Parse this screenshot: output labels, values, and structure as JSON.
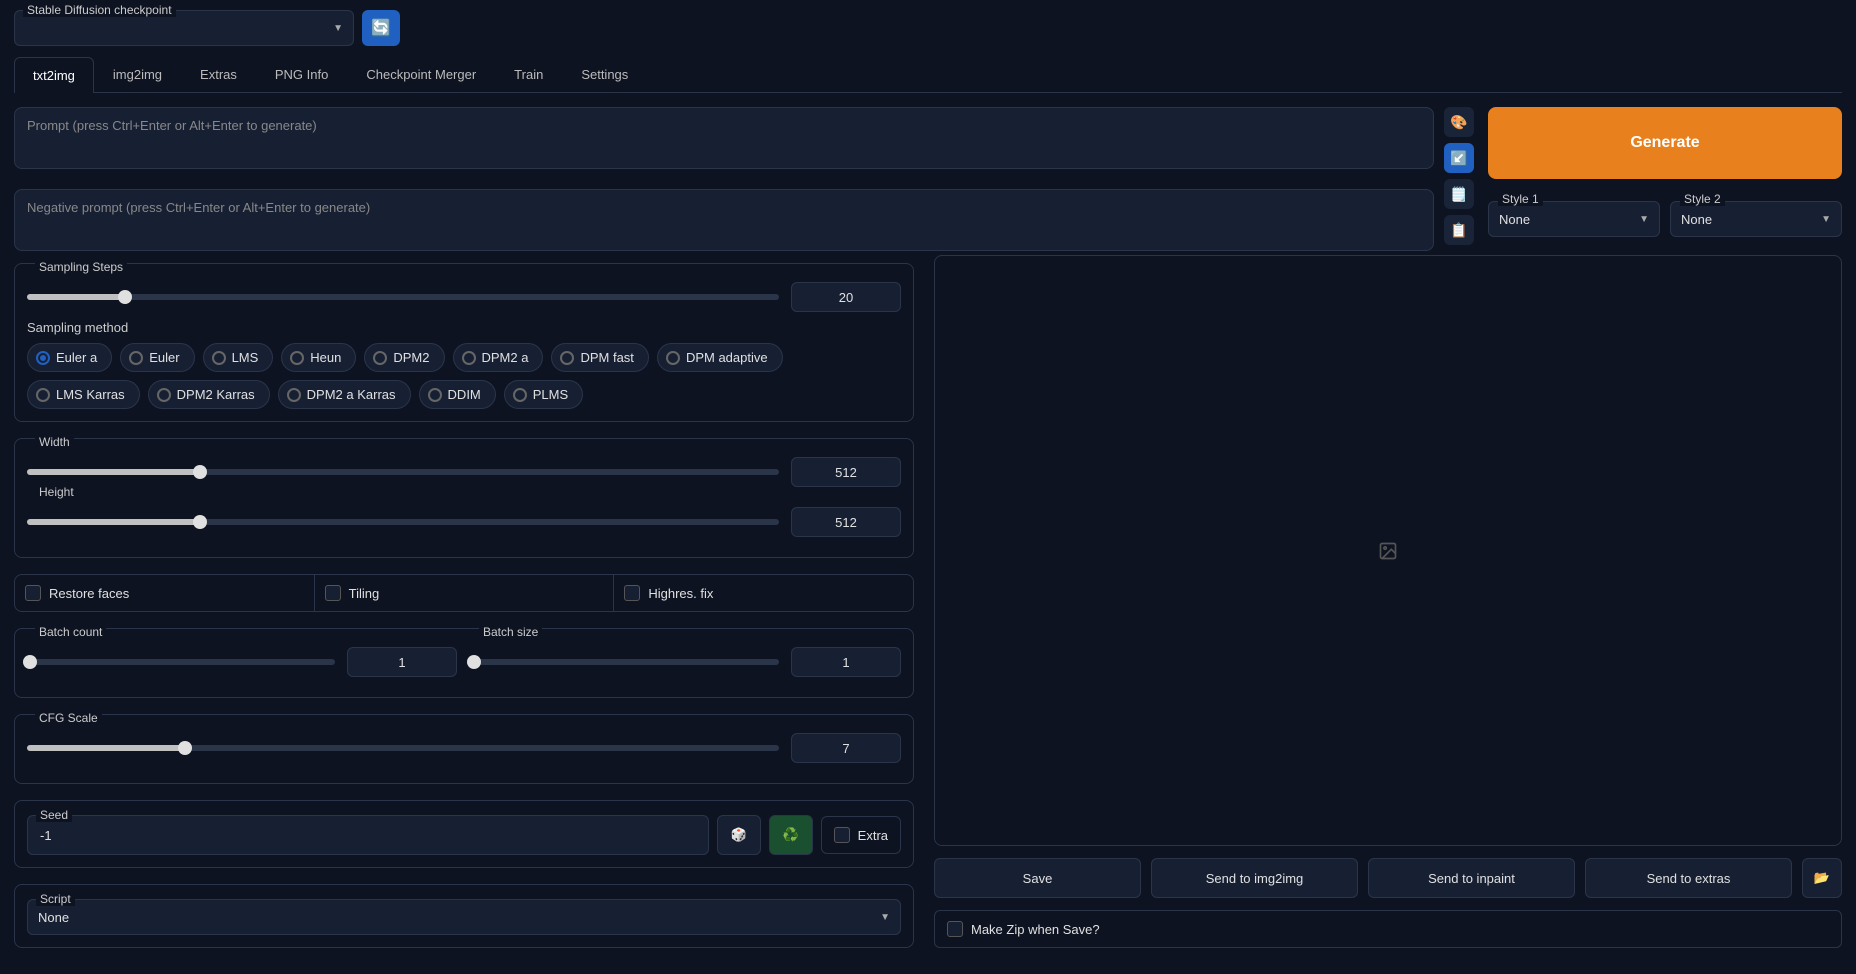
{
  "checkpoint": {
    "label": "Stable Diffusion checkpoint",
    "value": ""
  },
  "tabs": [
    "txt2img",
    "img2img",
    "Extras",
    "PNG Info",
    "Checkpoint Merger",
    "Train",
    "Settings"
  ],
  "active_tab": 0,
  "prompt": {
    "placeholder": "Prompt (press Ctrl+Enter or Alt+Enter to generate)"
  },
  "neg_prompt": {
    "placeholder": "Negative prompt (press Ctrl+Enter or Alt+Enter to generate)"
  },
  "generate_label": "Generate",
  "style1": {
    "label": "Style 1",
    "value": "None"
  },
  "style2": {
    "label": "Style 2",
    "value": "None"
  },
  "sampling_steps": {
    "label": "Sampling Steps",
    "value": "20",
    "pct": 13
  },
  "sampling_method": {
    "label": "Sampling method",
    "options": [
      "Euler a",
      "Euler",
      "LMS",
      "Heun",
      "DPM2",
      "DPM2 a",
      "DPM fast",
      "DPM adaptive",
      "LMS Karras",
      "DPM2 Karras",
      "DPM2 a Karras",
      "DDIM",
      "PLMS"
    ],
    "selected": 0
  },
  "width": {
    "label": "Width",
    "value": "512",
    "pct": 23
  },
  "height": {
    "label": "Height",
    "value": "512",
    "pct": 23
  },
  "restore_faces": "Restore faces",
  "tiling": "Tiling",
  "highres_fix": "Highres. fix",
  "batch_count": {
    "label": "Batch count",
    "value": "1",
    "pct": 0
  },
  "batch_size": {
    "label": "Batch size",
    "value": "1",
    "pct": 0
  },
  "cfg_scale": {
    "label": "CFG Scale",
    "value": "7",
    "pct": 21
  },
  "seed": {
    "label": "Seed",
    "value": "-1"
  },
  "extra_label": "Extra",
  "script": {
    "label": "Script",
    "value": "None"
  },
  "save_label": "Save",
  "send_img2img": "Send to img2img",
  "send_inpaint": "Send to inpaint",
  "send_extras": "Send to extras",
  "make_zip": "Make Zip when Save?",
  "icons": {
    "reload": "🔄",
    "palette": "🎨",
    "arrow": "↙️",
    "clipboard_img": "🗒️",
    "clipboard": "📋",
    "image": "🖼",
    "dice": "🎲",
    "recycle": "♻️",
    "folder": "📂"
  }
}
